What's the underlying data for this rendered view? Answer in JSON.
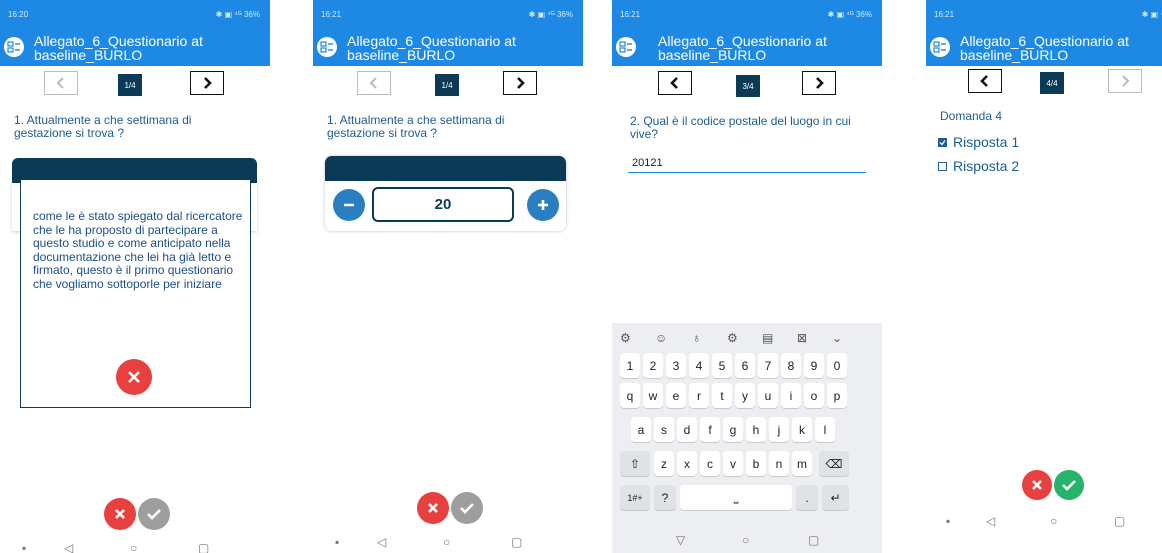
{
  "screens": [
    {
      "status_time": "16:20",
      "status_right": "✱ ▣ ⁴ᴳ 36%",
      "title": "Allegato_6_Questionario at baseline_BURLO",
      "page": "1/4",
      "question": "1. Attualmente a che settimana di gestazione si trova ?",
      "popup_text": "come le è stato spiegato dal ricercatore che le ha proposto di partecipare a questo studio e come anticipato nella documentazione che lei ha già letto e firmato, questo è il primo questionario che vogliamo sottoporle per iniziare"
    },
    {
      "status_time": "16:21",
      "status_right": "✱ ▣ ⁴ᴳ 36%",
      "title": "Allegato_6_Questionario at baseline_BURLO",
      "page": "1/4",
      "question": "1. Attualmente a che settimana di gestazione si trova ?",
      "stepper_value": "20"
    },
    {
      "status_time": "16:21",
      "status_right": "✱ ▣ ⁴ᴳ 36%",
      "title": "Allegato_6_Questionario at baseline_BURLO",
      "page": "3/4",
      "question": "2. Qual è il codice postale del luogo in cui vive?",
      "input_value": "20121",
      "keyboard": {
        "row1": [
          "1",
          "2",
          "3",
          "4",
          "5",
          "6",
          "7",
          "8",
          "9",
          "0"
        ],
        "row2": [
          "q",
          "w",
          "e",
          "r",
          "t",
          "y",
          "u",
          "i",
          "o",
          "p"
        ],
        "row3": [
          "a",
          "s",
          "d",
          "f",
          "g",
          "h",
          "j",
          "k",
          "l"
        ],
        "row4": [
          "z",
          "x",
          "c",
          "v",
          "b",
          "n",
          "m"
        ],
        "sym_label": "1#+",
        "question_key": "?",
        "period_key": "."
      }
    },
    {
      "status_time": "16:21",
      "status_right": "✱ ▣ ⁴ᴳ 36%",
      "title": "Allegato_6_Questionario at baseline_BURLO",
      "page": "4/4",
      "question": "Domanda 4",
      "options": [
        {
          "label": "Risposta 1",
          "checked": true
        },
        {
          "label": "Risposta 2",
          "checked": false
        }
      ]
    }
  ],
  "colors": {
    "appbar": "#1e88e5",
    "navy": "#0a3a55",
    "cancel": "#e8403f",
    "confirm_disabled": "#9e9e9e",
    "confirm": "#26b36b"
  },
  "icons": [
    "app-form-icon",
    "chevron-left-icon",
    "chevron-right-icon",
    "close-icon",
    "check-icon",
    "minus-icon",
    "plus-icon",
    "backspace-icon",
    "shift-icon",
    "enter-icon",
    "mic-icon",
    "emoji-icon",
    "settings-icon",
    "clipboard-icon"
  ]
}
